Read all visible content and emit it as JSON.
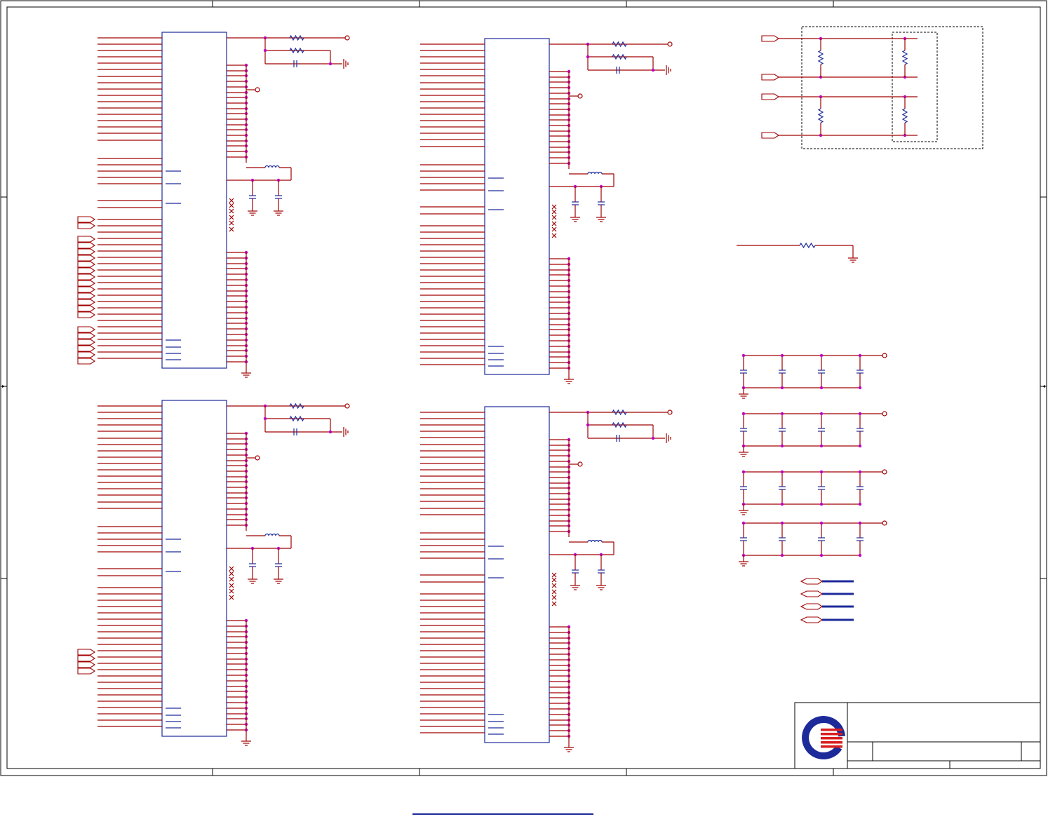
{
  "sheet": {
    "domain": "schematic",
    "colors": {
      "wire": "#a00000",
      "component": "#1d2a9a",
      "junction": "#c000c0",
      "frame": "#000000",
      "logo_blue": "#1d2a9a",
      "logo_red": "#d81e1e"
    },
    "icons": [
      "resistor-icon",
      "capacitor-icon",
      "inductor-icon",
      "ground-icon",
      "net-port-icon",
      "logo-icon"
    ],
    "title_block": {
      "title": "",
      "doc_number": "",
      "rev": ""
    }
  }
}
